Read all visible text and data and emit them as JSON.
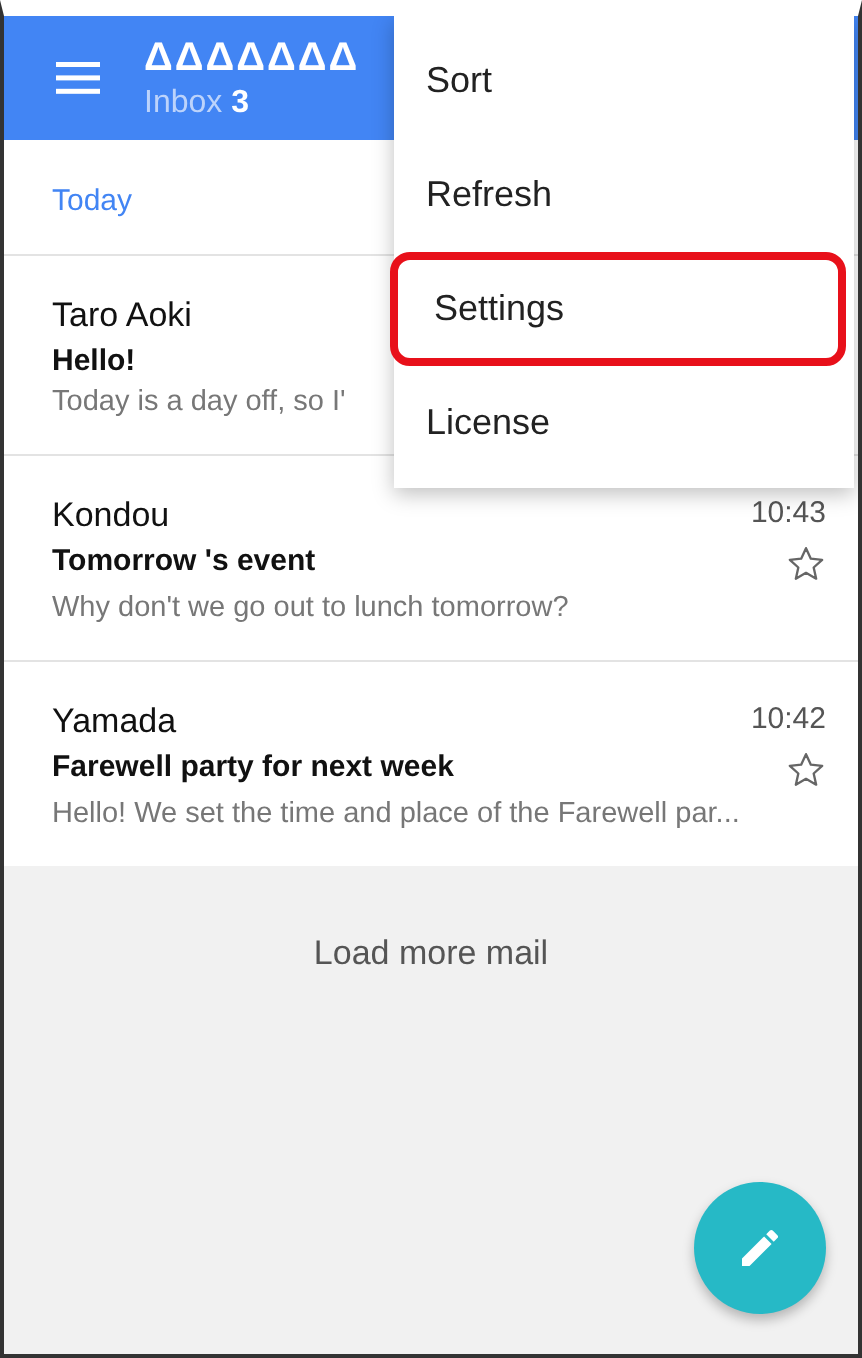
{
  "app_bar": {
    "title": "ΔΔΔΔΔΔΔ",
    "subtitle": "Inbox **3**"
  },
  "section": "Today",
  "messages": [
    {
      "sender": "Taro Aoki",
      "subject": "Hello!",
      "preview": "Today is a day off, so I'"
    },
    {
      "sender": "Kondou",
      "subject": "Tomorrow 's event",
      "preview": "Why don't we go out to lunch tomorrow?",
      "time": "10:43",
      "starred": false
    },
    {
      "sender": "Yamada",
      "subject": "Farewell party for next week",
      "preview": "Hello! We set the time and place of the Farewell par...",
      "time": "10:42",
      "starred": false
    }
  ],
  "load_more": "Load more mail",
  "menu": [
    {
      "label": "Sort",
      "highlighted": false
    },
    {
      "label": "Refresh",
      "highlighted": false
    },
    {
      "label": "Settings",
      "highlighted": true
    },
    {
      "label": "License",
      "highlighted": false
    }
  ]
}
